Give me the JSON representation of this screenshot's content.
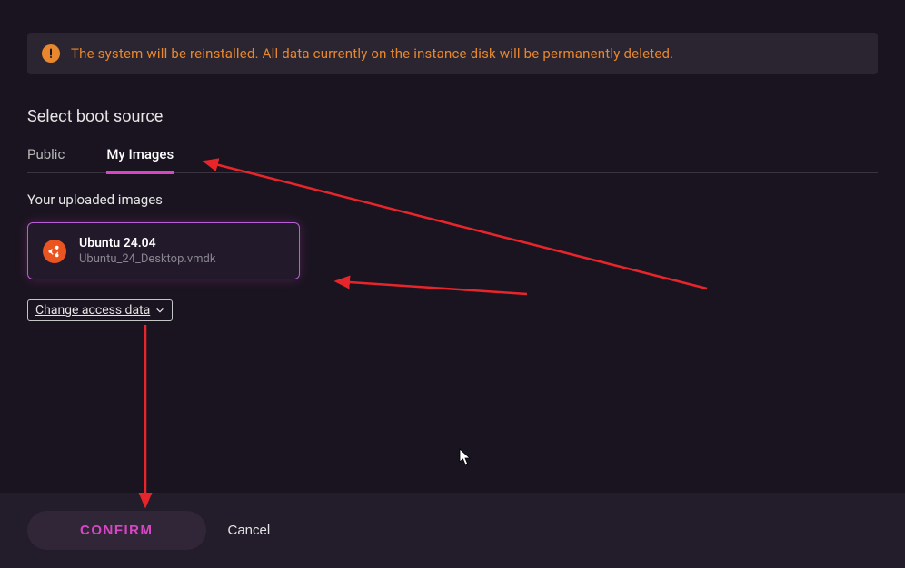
{
  "warning": {
    "text": "The system will be reinstalled. All data currently on the instance disk will be permanently deleted."
  },
  "section": {
    "title": "Select boot source"
  },
  "tabs": {
    "public": "Public",
    "my_images": "My Images"
  },
  "subsection": {
    "title": "Your uploaded images"
  },
  "image_card": {
    "name": "Ubuntu 24.04",
    "file": "Ubuntu_24_Desktop.vmdk"
  },
  "access_dropdown": {
    "label": "Change access data"
  },
  "footer": {
    "confirm": "CONFIRM",
    "cancel": "Cancel"
  },
  "colors": {
    "accent_pink": "#d946c5",
    "accent_orange": "#e8872e",
    "ubuntu_orange": "#e95420",
    "bg_dark": "#1a1420",
    "annotation_red": "#e8252a"
  }
}
